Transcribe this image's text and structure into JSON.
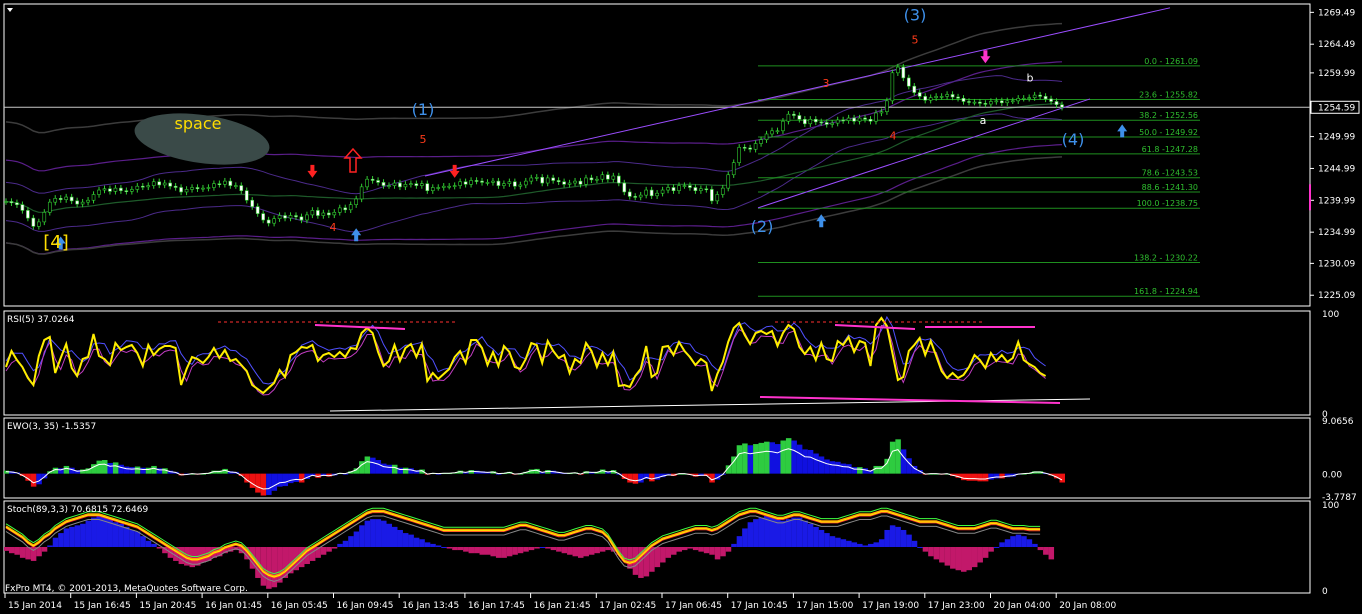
{
  "colors": {
    "background": "#000000",
    "grid_frame": "#ffffff",
    "price_candles": "#32cd32",
    "wave_label_blue": "#3e90ea",
    "wave_label_red": "#ff3b1a",
    "wave_label_yellow": "#ffde00",
    "channel_line": "#9b4dff",
    "fib_lines": "#1f8f1f",
    "rsi_line": "#ffee00",
    "ewo_up": "#2ecc40",
    "ewo_down": "#ee1111",
    "ewo_blue": "#1010e0",
    "stoch_blue": "#1a1ae6",
    "stoch_magenta": "#c2186a",
    "stoch_orange": "#ffa500"
  },
  "header": {
    "menu_icon": "triangle-down-icon"
  },
  "chart_data": [
    {
      "type": "line",
      "name_panel": "price",
      "y_ticks": [
        "1269.49",
        "1264.49",
        "1259.99",
        "1254.59",
        "1249.99",
        "1244.99",
        "1239.99",
        "1234.99",
        "1230.09",
        "1225.09"
      ],
      "ylim": [
        1223.4,
        1270.8
      ],
      "current_price_label": "1254.59",
      "current_price": 1254.59,
      "fib_levels": [
        {
          "label": "0.0 - 1261.09",
          "value": 1261.09
        },
        {
          "label": "23.6 - 1255.82",
          "value": 1255.82
        },
        {
          "label": "38.2 - 1252.56",
          "value": 1252.56
        },
        {
          "label": "50.0 - 1249.92",
          "value": 1249.92
        },
        {
          "label": "61.8 -1247.28",
          "value": 1247.28
        },
        {
          "label": "78.6 -1243.53",
          "value": 1243.53
        },
        {
          "label": "88.6 -1241.30",
          "value": 1241.3
        },
        {
          "label": "100.0 -1238.75",
          "value": 1238.75
        },
        {
          "label": "138.2 - 1230.22",
          "value": 1230.22
        },
        {
          "label": "161.8 - 1224.94",
          "value": 1224.94
        }
      ],
      "wave_labels": [
        {
          "text": "[4]",
          "color": "yellow",
          "price": 1232.5,
          "bar": 50
        },
        {
          "text": "space",
          "color": "yellow",
          "price": 1251.2,
          "bar": 195
        },
        {
          "text": "(1)",
          "color": "blue",
          "price": 1253.4,
          "bar": 423
        },
        {
          "text": "5",
          "color": "red",
          "price": 1249.0,
          "bar": 423
        },
        {
          "text": "4",
          "color": "red",
          "price": 1235.2,
          "bar": 333
        },
        {
          "text": "(2)",
          "color": "blue",
          "price": 1235.0,
          "bar": 762
        },
        {
          "text": "3",
          "color": "red",
          "price": 1257.8,
          "bar": 826
        },
        {
          "text": "4",
          "color": "red",
          "price": 1249.5,
          "bar": 893
        },
        {
          "text": "(3)",
          "color": "blue",
          "price": 1268.2,
          "bar": 915
        },
        {
          "text": "5",
          "color": "red",
          "price": 1264.6,
          "bar": 915
        },
        {
          "text": "a",
          "color": "white",
          "price": 1252.0,
          "bar": 983
        },
        {
          "text": "b",
          "color": "white",
          "price": 1258.6,
          "bar": 1030
        },
        {
          "text": "(4)",
          "color": "blue",
          "price": 1248.7,
          "bar": 1073
        }
      ],
      "close_series": [
        1239.8,
        1239.6,
        1239.3,
        1238.4,
        1237.2,
        1235.9,
        1236.6,
        1238.1,
        1239.7,
        1240.3,
        1240.1,
        1240.5,
        1239.9,
        1239.4,
        1239.7,
        1240.0,
        1240.9,
        1241.6,
        1241.8,
        1241.4,
        1241.9,
        1241.5,
        1241.4,
        1241.7,
        1242.2,
        1242.1,
        1242.3,
        1242.9,
        1242.4,
        1242.7,
        1242.2,
        1242.0,
        1241.3,
        1241.7,
        1242.0,
        1241.8,
        1241.9,
        1242.0,
        1242.6,
        1242.5,
        1243.0,
        1242.3,
        1242.3,
        1241.5,
        1240.0,
        1239.0,
        1237.9,
        1236.9,
        1236.4,
        1237.1,
        1237.6,
        1237.2,
        1237.6,
        1237.4,
        1236.9,
        1237.7,
        1238.4,
        1237.6,
        1238.0,
        1237.7,
        1238.1,
        1238.8,
        1238.5,
        1239.3,
        1240.2,
        1242.1,
        1243.3,
        1243.1,
        1242.8,
        1242.3,
        1242.3,
        1242.7,
        1242.1,
        1242.5,
        1242.6,
        1242.3,
        1242.6,
        1241.5,
        1242.0,
        1242.0,
        1242.2,
        1242.2,
        1242.3,
        1242.9,
        1242.5,
        1243.1,
        1243.0,
        1242.8,
        1242.8,
        1243.0,
        1242.3,
        1242.6,
        1242.9,
        1242.2,
        1242.4,
        1243.0,
        1243.5,
        1243.6,
        1242.7,
        1243.5,
        1243.1,
        1242.9,
        1242.5,
        1242.7,
        1243.0,
        1242.5,
        1243.5,
        1243.2,
        1243.3,
        1244.0,
        1243.3,
        1243.8,
        1242.7,
        1241.3,
        1240.6,
        1240.5,
        1240.8,
        1241.6,
        1240.7,
        1241.1,
        1241.6,
        1242.0,
        1241.5,
        1242.3,
        1242.3,
        1242.0,
        1241.5,
        1241.8,
        1241.7,
        1239.9,
        1240.9,
        1241.9,
        1244.0,
        1245.9,
        1248.3,
        1248.2,
        1248.0,
        1248.9,
        1249.5,
        1250.4,
        1250.9,
        1250.9,
        1252.4,
        1253.5,
        1253.3,
        1252.7,
        1252.0,
        1252.7,
        1252.3,
        1252.2,
        1251.9,
        1252.1,
        1252.6,
        1252.5,
        1252.9,
        1252.4,
        1252.9,
        1252.7,
        1252.4,
        1253.7,
        1253.9,
        1255.6,
        1260.0,
        1260.9,
        1259.2,
        1257.9,
        1256.9,
        1256.3,
        1255.7,
        1256.1,
        1256.3,
        1256.3,
        1256.6,
        1256.2,
        1256.0,
        1255.5,
        1255.4,
        1255.4,
        1255.2,
        1255.1,
        1255.5,
        1255.6,
        1255.3,
        1255.6,
        1255.6,
        1256.0,
        1256.0,
        1256.1,
        1256.5,
        1256.3,
        1255.9,
        1255.5,
        1255.0,
        1254.6
      ]
    },
    {
      "type": "line",
      "name_panel": "rsi",
      "label": "RSI(5) 37.0264",
      "y_ticks": [
        "100",
        "0"
      ],
      "ylim": [
        0,
        100
      ],
      "values": [
        46,
        62,
        53,
        46,
        35,
        28,
        57,
        73,
        76,
        40,
        55,
        69,
        45,
        37,
        54,
        56,
        79,
        57,
        54,
        48,
        70,
        63,
        66,
        68,
        60,
        47,
        68,
        58,
        64,
        67,
        67,
        65,
        28,
        44,
        56,
        54,
        50,
        56,
        65,
        55,
        63,
        52,
        54,
        48,
        42,
        28,
        24,
        20,
        25,
        30,
        43,
        36,
        58,
        61,
        66,
        65,
        68,
        52,
        58,
        60,
        56,
        61,
        56,
        65,
        64,
        80,
        85,
        80,
        61,
        47,
        52,
        68,
        52,
        65,
        69,
        56,
        69,
        32,
        40,
        34,
        39,
        44,
        56,
        62,
        50,
        73,
        73,
        65,
        48,
        61,
        47,
        67,
        61,
        46,
        44,
        54,
        70,
        68,
        50,
        72,
        62,
        55,
        58,
        40,
        54,
        50,
        70,
        62,
        46,
        60,
        48,
        61,
        27,
        28,
        26,
        37,
        44,
        67,
        36,
        40,
        66,
        67,
        58,
        71,
        62,
        56,
        48,
        54,
        50,
        22,
        39,
        51,
        71,
        85,
        90,
        78,
        69,
        80,
        82,
        79,
        82,
        67,
        80,
        88,
        84,
        66,
        59,
        66,
        53,
        70,
        54,
        52,
        72,
        68,
        76,
        61,
        72,
        70,
        47,
        88,
        95,
        87,
        60,
        33,
        36,
        62,
        68,
        75,
        58,
        72,
        57,
        42,
        35,
        40,
        35,
        38,
        46,
        58,
        53,
        45,
        60,
        52,
        58,
        51,
        55,
        71,
        53,
        49,
        46,
        40,
        37
      ]
    },
    {
      "type": "bar",
      "name_panel": "ewo",
      "label": "EWO(3, 35) -1.5357",
      "y_ticks": [
        "9.0656",
        "0.00",
        "-3.7787"
      ],
      "ylim": [
        -3.7787,
        9.0656
      ],
      "values": [
        0.5,
        0.4,
        0.2,
        -0.4,
        -1.2,
        -2.2,
        -1.8,
        -0.8,
        0.4,
        1.0,
        0.9,
        1.3,
        1.0,
        0.6,
        0.7,
        0.9,
        1.6,
        2.2,
        2.3,
        1.8,
        1.9,
        1.5,
        1.2,
        1.1,
        1.2,
        1.0,
        1.0,
        1.3,
        0.9,
        0.9,
        0.5,
        0.3,
        -0.3,
        -0.2,
        0.0,
        -0.1,
        0.0,
        0.1,
        0.5,
        0.5,
        0.8,
        0.4,
        0.3,
        -0.4,
        -1.5,
        -2.4,
        -3.2,
        -3.7,
        -3.6,
        -2.9,
        -2.2,
        -2.1,
        -1.6,
        -1.4,
        -1.5,
        -0.9,
        -0.4,
        -0.7,
        -0.4,
        -0.5,
        -0.3,
        0.1,
        0.0,
        0.4,
        0.9,
        2.1,
        2.9,
        2.7,
        2.3,
        1.7,
        1.5,
        1.5,
        1.0,
        1.0,
        0.9,
        0.6,
        0.7,
        -0.1,
        0.1,
        0.0,
        0.1,
        0.1,
        0.2,
        0.5,
        0.3,
        0.6,
        0.5,
        0.4,
        0.3,
        0.4,
        0.0,
        0.1,
        0.3,
        -0.1,
        0.0,
        0.3,
        0.7,
        0.8,
        0.3,
        0.6,
        0.5,
        0.3,
        0.1,
        0.1,
        0.2,
        -0.1,
        0.4,
        0.3,
        0.3,
        0.7,
        0.4,
        0.6,
        0.0,
        -0.9,
        -1.5,
        -1.7,
        -1.5,
        -0.9,
        -1.3,
        -1.0,
        -0.6,
        -0.3,
        -0.4,
        0.0,
        0.0,
        -0.2,
        -0.5,
        -0.4,
        -0.4,
        -1.5,
        -1.0,
        -0.2,
        1.4,
        2.9,
        4.8,
        5.1,
        4.8,
        5.0,
        5.2,
        5.4,
        5.3,
        5.0,
        5.6,
        6.0,
        5.6,
        4.9,
        4.1,
        4.0,
        3.4,
        2.9,
        2.4,
        2.1,
        2.0,
        1.7,
        1.6,
        1.1,
        1.1,
        0.9,
        0.6,
        1.3,
        1.3,
        2.5,
        5.4,
        5.8,
        4.1,
        2.6,
        1.3,
        0.6,
        -0.1,
        0.0,
        0.0,
        -0.1,
        0.0,
        -0.4,
        -0.7,
        -1.1,
        -1.2,
        -1.2,
        -1.3,
        -1.3,
        -1.0,
        -0.8,
        -0.8,
        -0.6,
        -0.5,
        -0.1,
        0.0,
        0.1,
        0.4,
        0.4,
        0.1,
        -0.3,
        -0.8,
        -1.5
      ]
    },
    {
      "type": "bar",
      "name_panel": "stoch",
      "label": "Stoch(89,3,3) 70.6815 72.6469",
      "y_ticks": [
        "100",
        "0"
      ],
      "ylim": [
        0,
        100
      ],
      "values": [
        -5,
        -8,
        -10,
        -14,
        -16,
        -18,
        -12,
        -6,
        2,
        12,
        18,
        24,
        26,
        28,
        30,
        34,
        38,
        40,
        40,
        36,
        32,
        30,
        26,
        22,
        20,
        14,
        8,
        4,
        -2,
        -8,
        -14,
        -18,
        -22,
        -24,
        -26,
        -24,
        -20,
        -18,
        -14,
        -12,
        -8,
        -6,
        -4,
        -8,
        -16,
        -28,
        -40,
        -50,
        -54,
        -52,
        -46,
        -40,
        -34,
        -30,
        -26,
        -22,
        -18,
        -14,
        -10,
        -6,
        -2,
        4,
        8,
        14,
        20,
        28,
        34,
        36,
        36,
        34,
        30,
        26,
        22,
        18,
        16,
        12,
        10,
        6,
        4,
        2,
        0,
        -2,
        -4,
        -4,
        -6,
        -8,
        -8,
        -10,
        -10,
        -12,
        -14,
        -14,
        -12,
        -10,
        -8,
        -6,
        -4,
        -2,
        0,
        -2,
        -4,
        -6,
        -8,
        -10,
        -12,
        -14,
        -12,
        -10,
        -8,
        -6,
        -4,
        -6,
        -10,
        -18,
        -28,
        -36,
        -40,
        -38,
        -32,
        -26,
        -20,
        -14,
        -10,
        -6,
        -4,
        -2,
        -4,
        -6,
        -8,
        -10,
        -16,
        -12,
        -6,
        4,
        14,
        24,
        32,
        36,
        38,
        40,
        38,
        36,
        34,
        36,
        38,
        38,
        34,
        30,
        26,
        22,
        18,
        14,
        12,
        10,
        8,
        6,
        4,
        2,
        4,
        6,
        10,
        22,
        28,
        26,
        22,
        16,
        8,
        0,
        -6,
        -12,
        -16,
        -20,
        -24,
        -28,
        -30,
        -32,
        -30,
        -26,
        -20,
        -14,
        -6,
        0,
        6,
        10,
        14,
        16,
        14,
        10,
        4,
        -4,
        -10,
        -16
      ],
      "k_line": [
        74,
        70,
        66,
        62,
        56,
        52,
        56,
        62,
        66,
        72,
        76,
        80,
        82,
        84,
        86,
        88,
        88,
        88,
        86,
        84,
        82,
        80,
        78,
        76,
        74,
        70,
        66,
        62,
        58,
        54,
        50,
        46,
        42,
        38,
        36,
        36,
        38,
        40,
        44,
        46,
        50,
        52,
        54,
        52,
        46,
        38,
        30,
        22,
        18,
        16,
        18,
        22,
        28,
        34,
        40,
        46,
        50,
        54,
        58,
        62,
        66,
        70,
        74,
        78,
        82,
        86,
        90,
        92,
        92,
        92,
        90,
        88,
        86,
        84,
        82,
        80,
        78,
        76,
        74,
        72,
        70,
        70,
        70,
        70,
        70,
        70,
        70,
        70,
        70,
        70,
        70,
        70,
        72,
        74,
        76,
        76,
        74,
        72,
        70,
        68,
        66,
        64,
        64,
        66,
        68,
        70,
        72,
        72,
        70,
        68,
        62,
        52,
        42,
        34,
        32,
        34,
        40,
        46,
        52,
        56,
        60,
        62,
        64,
        66,
        68,
        70,
        72,
        72,
        72,
        70,
        72,
        76,
        80,
        84,
        88,
        90,
        92,
        92,
        90,
        88,
        86,
        84,
        84,
        86,
        88,
        88,
        86,
        84,
        82,
        80,
        80,
        80,
        80,
        82,
        84,
        86,
        88,
        88,
        88,
        90,
        92,
        92,
        90,
        88,
        86,
        84,
        82,
        80,
        80,
        80,
        80,
        78,
        76,
        74,
        72,
        72,
        72,
        72,
        74,
        76,
        78,
        78,
        76,
        74,
        72,
        72,
        72,
        71,
        71,
        71
      ],
      "k_line_label": "70.6815",
      "d_line_label": "72.6469"
    }
  ],
  "time_axis": [
    "15 Jan 2014",
    "15 Jan 16:45",
    "15 Jan 20:45",
    "16 Jan 01:45",
    "16 Jan 05:45",
    "16 Jan 09:45",
    "16 Jan 13:45",
    "16 Jan 17:45",
    "16 Jan 21:45",
    "17 Jan 02:45",
    "17 Jan 06:45",
    "17 Jan 10:45",
    "17 Jan 15:00",
    "17 Jan 19:00",
    "17 Jan 23:00",
    "20 Jan 04:00",
    "20 Jan 08:00"
  ],
  "footer": {
    "copyright": "FxPro MT4, © 2001-2013, MetaQuotes Software Corp."
  }
}
